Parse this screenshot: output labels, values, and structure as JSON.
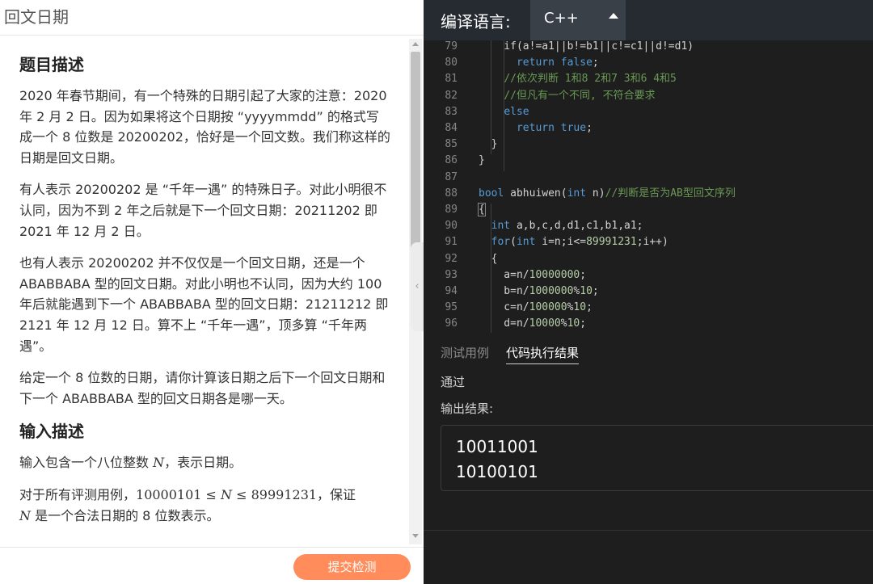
{
  "page_title": "回文日期",
  "problem": {
    "desc_heading": "题目描述",
    "p1": "2020 年春节期间，有一个特殊的日期引起了大家的注意：2020 年 2 月 2 日。因为如果将这个日期按 “yyyymmdd” 的格式写成一个 8 位数是 20200202，恰好是一个回文数。我们称这样的日期是回文日期。",
    "p2": "有人表示 20200202 是 “千年一遇” 的特殊日子。对此小明很不认同，因为不到 2 年之后就是下一个回文日期：20211202 即 2021 年 12 月 2 日。",
    "p3": "也有人表示 20200202 并不仅仅是一个回文日期，还是一个 ABABBABA 型的回文日期。对此小明也不认同，因为大约 100 年后就能遇到下一个 ABABBABA 型的回文日期：21211212 即 2121 年 12 月 12 日。算不上 “千年一遇”，顶多算 “千年两遇”。",
    "p4": "给定一个 8 位数的日期，请你计算该日期之后下一个回文日期和下一个 ABABBABA 型的回文日期各是哪一天。",
    "input_heading": "输入描述",
    "input_p1_pre": "输入包含一个八位整数 ",
    "input_p1_var": "N",
    "input_p1_post": "，表示日期。",
    "input_p2_pre": "对于所有评测用例，",
    "input_p2_math": "10000101 ≤ ",
    "input_p2_var": "N",
    "input_p2_math2": " ≤ 89991231",
    "input_p2_post": "，保证",
    "input_p3_var": "N",
    "input_p3_text": " 是一个合法日期的 8 位数表示。"
  },
  "submit_label": "提交检测",
  "editor": {
    "lang_label": "编译语言:",
    "lang_value": "C++"
  },
  "code_lines": [
    {
      "n": "79",
      "segs": [
        {
          "t": "    if(a!=a1||b!=b1||c!=c1||d!=d1)",
          "c": ""
        }
      ]
    },
    {
      "n": "80",
      "segs": [
        {
          "t": "      ",
          "c": ""
        },
        {
          "t": "return",
          "c": "kw"
        },
        {
          "t": " ",
          "c": ""
        },
        {
          "t": "false",
          "c": "kw"
        },
        {
          "t": ";",
          "c": ""
        }
      ]
    },
    {
      "n": "81",
      "segs": [
        {
          "t": "    ",
          "c": ""
        },
        {
          "t": "//依次判断 1和8 2和7 3和6 4和5",
          "c": "cmt"
        }
      ]
    },
    {
      "n": "82",
      "segs": [
        {
          "t": "    ",
          "c": ""
        },
        {
          "t": "//但凡有一个不同, 不符合要求",
          "c": "cmt"
        }
      ]
    },
    {
      "n": "83",
      "segs": [
        {
          "t": "    ",
          "c": ""
        },
        {
          "t": "else",
          "c": "kw"
        }
      ]
    },
    {
      "n": "84",
      "segs": [
        {
          "t": "      ",
          "c": ""
        },
        {
          "t": "return",
          "c": "kw"
        },
        {
          "t": " ",
          "c": ""
        },
        {
          "t": "true",
          "c": "kw"
        },
        {
          "t": ";",
          "c": ""
        }
      ]
    },
    {
      "n": "85",
      "segs": [
        {
          "t": "  }",
          "c": ""
        }
      ]
    },
    {
      "n": "86",
      "segs": [
        {
          "t": "}",
          "c": ""
        }
      ]
    },
    {
      "n": "87",
      "segs": [
        {
          "t": "",
          "c": ""
        }
      ]
    },
    {
      "n": "88",
      "segs": [
        {
          "t": "bool",
          "c": "kw"
        },
        {
          "t": " abhuiwen(",
          "c": ""
        },
        {
          "t": "int",
          "c": "kw"
        },
        {
          "t": " n)",
          "c": ""
        },
        {
          "t": "//判断是否为AB型回文序列",
          "c": "cmt"
        }
      ]
    },
    {
      "n": "89",
      "segs": [
        {
          "t": "{",
          "c": "bracket"
        }
      ]
    },
    {
      "n": "90",
      "segs": [
        {
          "t": "  ",
          "c": ""
        },
        {
          "t": "int",
          "c": "kw"
        },
        {
          "t": " a,b,c,d,d1,c1,b1,a1;",
          "c": ""
        }
      ]
    },
    {
      "n": "91",
      "segs": [
        {
          "t": "  ",
          "c": ""
        },
        {
          "t": "for",
          "c": "kw"
        },
        {
          "t": "(",
          "c": ""
        },
        {
          "t": "int",
          "c": "kw"
        },
        {
          "t": " i=n;i<=",
          "c": ""
        },
        {
          "t": "89991231",
          "c": "num"
        },
        {
          "t": ";i++)",
          "c": ""
        }
      ]
    },
    {
      "n": "92",
      "segs": [
        {
          "t": "  {",
          "c": ""
        }
      ]
    },
    {
      "n": "93",
      "segs": [
        {
          "t": "    a=n/",
          "c": ""
        },
        {
          "t": "10000000",
          "c": "num"
        },
        {
          "t": ";",
          "c": ""
        }
      ]
    },
    {
      "n": "94",
      "segs": [
        {
          "t": "    b=n/",
          "c": ""
        },
        {
          "t": "1000000",
          "c": "num"
        },
        {
          "t": "%",
          "c": ""
        },
        {
          "t": "10",
          "c": "num"
        },
        {
          "t": ";",
          "c": ""
        }
      ]
    },
    {
      "n": "95",
      "segs": [
        {
          "t": "    c=n/",
          "c": ""
        },
        {
          "t": "100000",
          "c": "num"
        },
        {
          "t": "%",
          "c": ""
        },
        {
          "t": "10",
          "c": "num"
        },
        {
          "t": ";",
          "c": ""
        }
      ]
    },
    {
      "n": "96",
      "segs": [
        {
          "t": "    d=n/",
          "c": ""
        },
        {
          "t": "10000",
          "c": "num"
        },
        {
          "t": "%",
          "c": ""
        },
        {
          "t": "10",
          "c": "num"
        },
        {
          "t": ";",
          "c": ""
        }
      ]
    }
  ],
  "results": {
    "tab_test": "测试用例",
    "tab_result": "代码执行结果",
    "status": "通过",
    "output_label": "输出结果:",
    "output_line1": "10011001",
    "output_line2": "10100101"
  }
}
